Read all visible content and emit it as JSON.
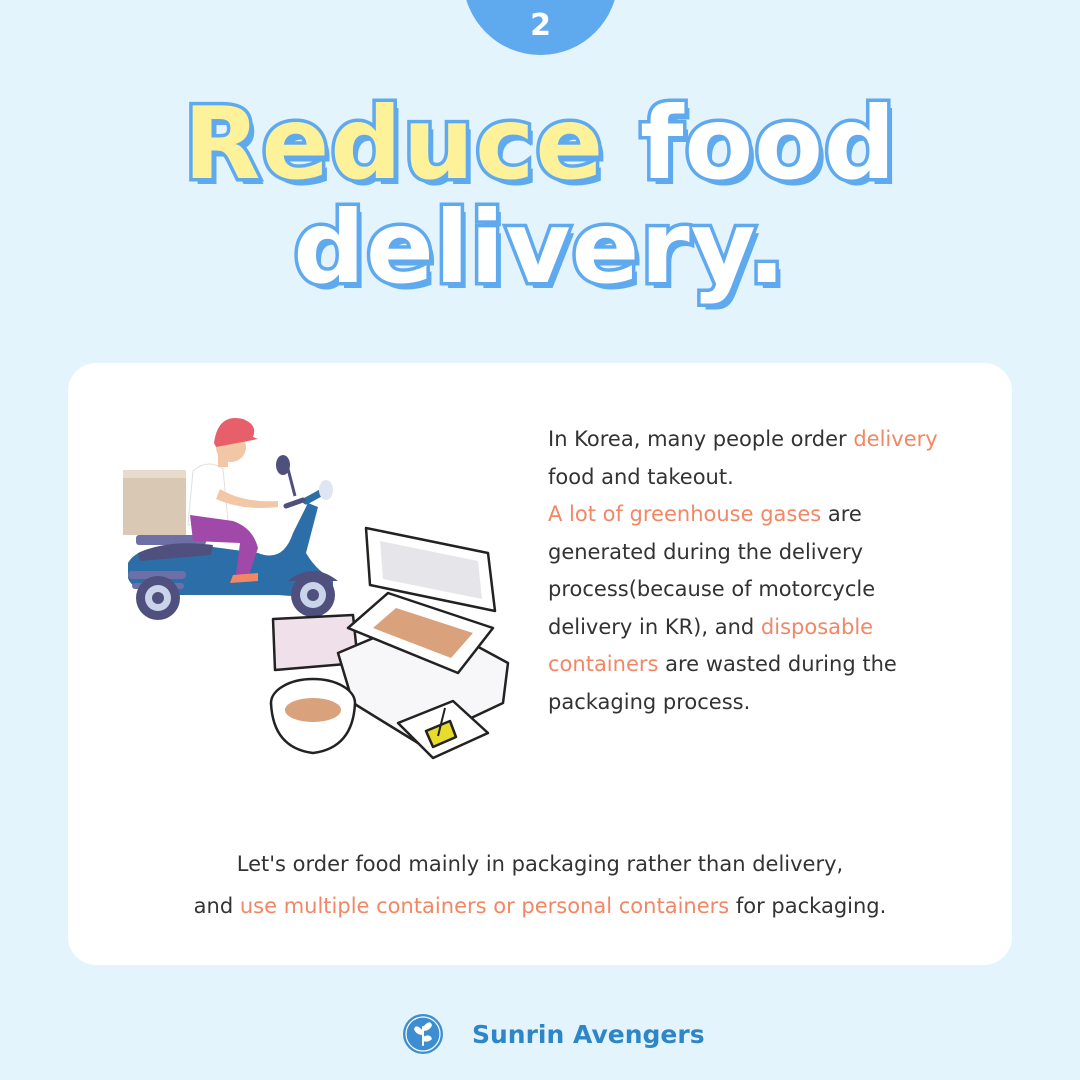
{
  "page_number": "2",
  "title": {
    "word1": "Reduce",
    "word2": "food",
    "line2": "delivery."
  },
  "paragraph": {
    "p1": "In Korea, many people order ",
    "p1_hl": "delivery",
    "p2": "food and takeout.",
    "p3_hl": "A lot of greenhouse gases",
    "p3": " are",
    "p4": "generated during the delivery",
    "p5": "process(because of motorcycle",
    "p6a": "delivery in KR), and ",
    "p6_hl": "disposable",
    "p7_hl": "containers",
    "p7": " are wasted during the",
    "p8": "packaging process."
  },
  "footer": {
    "line1": "Let's order food mainly in packaging rather than delivery,",
    "line2a": "and ",
    "line2_hl": "use multiple containers or personal containers",
    "line2b": " for packaging."
  },
  "brand": {
    "name": "Sunrin Avengers"
  },
  "colors": {
    "background": "#e3f4fd",
    "accent_blue": "#5fa9ee",
    "highlight": "#f28765",
    "title_yellow": "#fdf29a"
  },
  "icons": [
    "delivery-scooter-illustration",
    "food-containers-illustration",
    "sprout-logo-icon"
  ]
}
